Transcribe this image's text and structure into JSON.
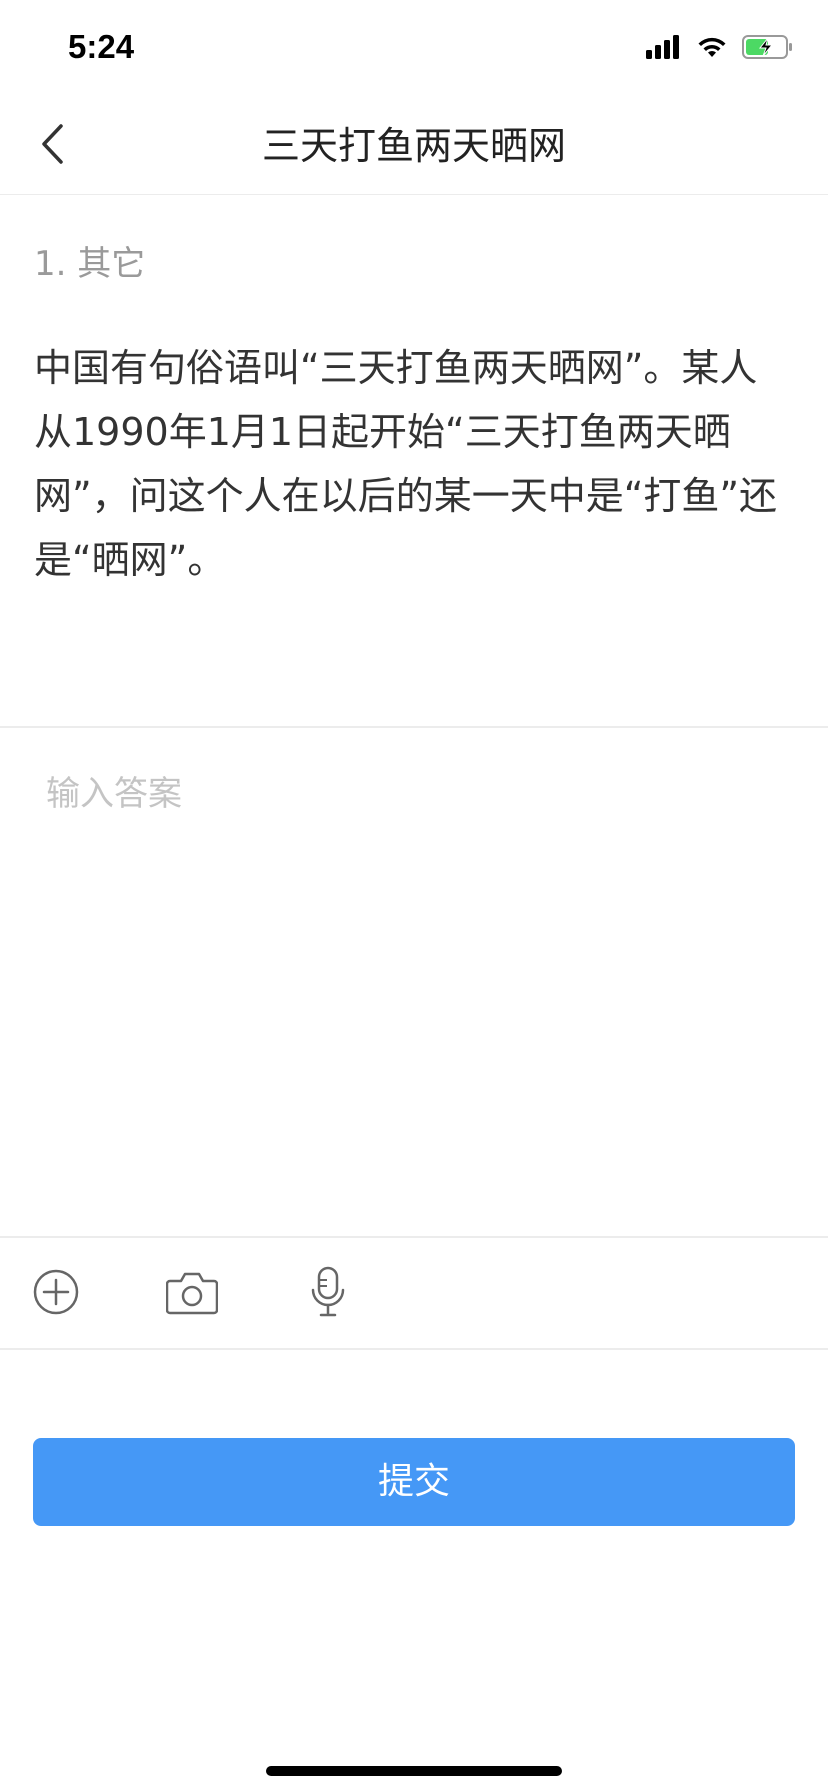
{
  "status_bar": {
    "time": "5:24"
  },
  "nav": {
    "title": "三天打鱼两天晒网"
  },
  "question": {
    "number_label": "1. 其它",
    "text": "中国有句俗语叫“三天打鱼两天晒网”。某人从1990年1月1日起开始“三天打鱼两天晒网”，问这个人在以后的某一天中是“打鱼”还是“晒网”。"
  },
  "answer": {
    "value": "",
    "placeholder": "输入答案"
  },
  "toolbar": {
    "icons": [
      "add-icon",
      "camera-icon",
      "microphone-icon"
    ]
  },
  "submit": {
    "label": "提交"
  },
  "colors": {
    "accent": "#4598f6",
    "battery": "#4cd964",
    "placeholder": "#c4c4c4",
    "muted_text": "#9a9a9a"
  }
}
